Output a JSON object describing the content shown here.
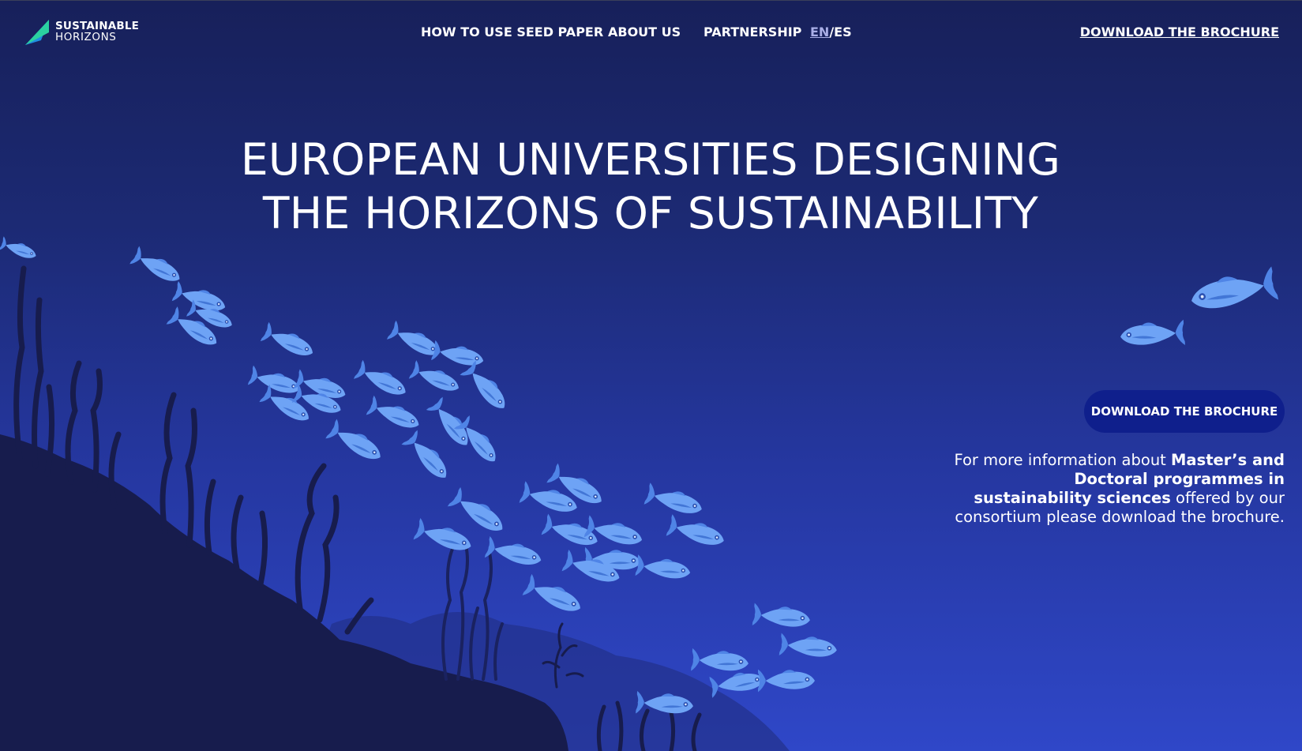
{
  "brand": {
    "name_line1": "SUSTAINABLE",
    "name_line2": "HORIZONS",
    "colors": {
      "bg_top": "#17205a",
      "bg_bottom": "#2f47c8",
      "fish": "#5b90ee",
      "seabed": "#171c4d",
      "button": "#0f1f8c",
      "logo_green": "#2bd1a0",
      "logo_blue": "#1f8fe0"
    }
  },
  "nav": {
    "items": [
      {
        "label": "HOW TO USE SEED PAPER"
      },
      {
        "label": "ABOUT US"
      },
      {
        "label": "PARTNERSHIP"
      }
    ],
    "lang_en": "EN",
    "lang_sep": "/",
    "lang_es": "ES",
    "download_label": "DOWNLOAD THE BROCHURE"
  },
  "hero": {
    "title_line1": "EUROPEAN UNIVERSITIES DESIGNING",
    "title_line2": "THE HORIZONS OF SUSTAINABILITY",
    "cta_label": "DOWNLOAD THE BROCHURE",
    "info": {
      "text1": "For more information about ",
      "bold": "Master’s and Doctoral programmes in sustainability sciences",
      "text2": " offered by our consortium please download the brochure."
    }
  },
  "icons": {
    "logo": "sustainable-horizons-logo",
    "fish": "fish-icon",
    "seaweed": "seaweed-icon"
  }
}
